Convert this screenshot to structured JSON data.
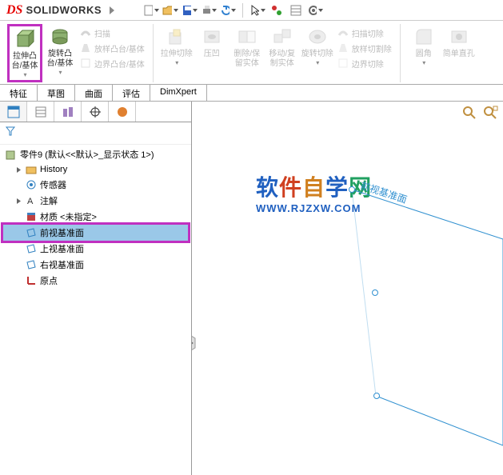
{
  "app": {
    "name": "SOLIDWORKS"
  },
  "toolbar": {
    "new": "新建",
    "open": "打开",
    "save": "保存",
    "print": "打印",
    "undo": "撤销",
    "select": "选择",
    "rebuild": "重建",
    "options": "选项"
  },
  "ribbon": {
    "extrude": "拉伸凸台/基体",
    "revolve": "旋转凸台/基体",
    "sweep": "扫描",
    "loft": "放样凸台/基体",
    "boundary": "边界凸台/基体",
    "extrudeCut": "拉伸切除",
    "hole": "压凹",
    "deleteKeep": "删除/保留实体",
    "moveCopy": "移动/复制实体",
    "revolveCut": "旋转切除",
    "sweepCut": "扫描切除",
    "loftCut": "放样切割除",
    "boundaryCut": "边界切除",
    "fillet": "圆角",
    "chamfer": "简单直孔"
  },
  "tabs": [
    "特征",
    "草图",
    "曲面",
    "评估",
    "DimXpert"
  ],
  "tree": {
    "root": "零件9  (默认<<默认>_显示状态 1>)",
    "history": "History",
    "sensors": "传感器",
    "annotations": "注解",
    "material": "材质 <未指定>",
    "frontPlane": "前视基准面",
    "topPlane": "上视基准面",
    "rightPlane": "右视基准面",
    "origin": "原点"
  },
  "viewport": {
    "planeLabel": "前视基准面",
    "watermark1": "软件自学网",
    "watermark2": "WWW.RJZXW.COM"
  }
}
